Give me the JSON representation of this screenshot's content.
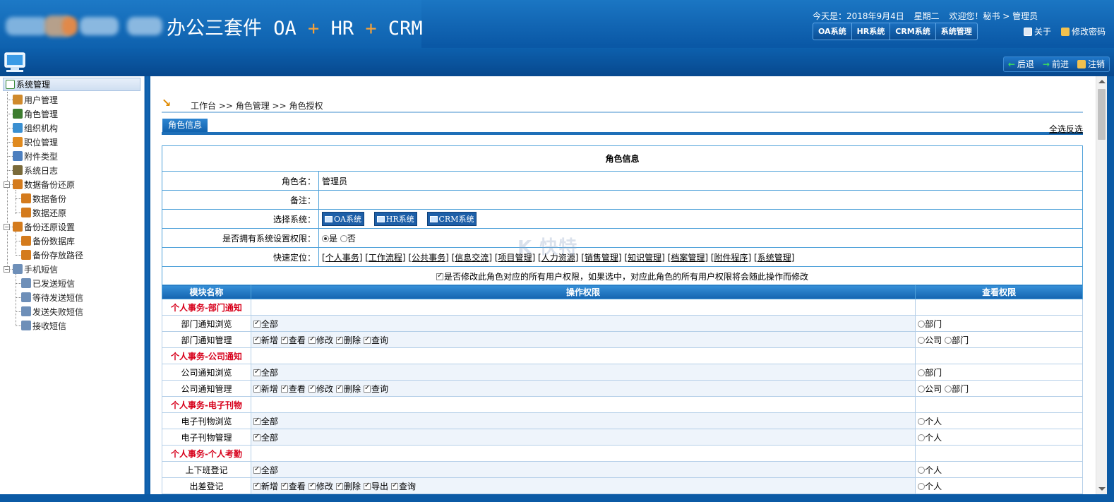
{
  "header": {
    "app_title": "办公三套件 OA + HR + CRM",
    "title_part1": "办公三套件 OA ",
    "title_part2": "HR",
    "title_part3": "CRM",
    "plus": "+",
    "date_text": "今天是：2018年9月4日",
    "weekday": "星期二",
    "welcome": "欢迎您！秘书 > 管理员",
    "system_tabs": [
      "OA系统",
      "HR系统",
      "CRM系统",
      "系统管理"
    ],
    "about": "关于",
    "change_password": "修改密码",
    "nav_back": "后退",
    "nav_forward": "前进",
    "nav_logout": "注销"
  },
  "sidebar": {
    "root": "系统管理",
    "items": [
      {
        "label": "用户管理",
        "color": "#d08a2c"
      },
      {
        "label": "角色管理",
        "color": "#3d7c2f"
      },
      {
        "label": "组织机构",
        "color": "#3a8fd1"
      },
      {
        "label": "职位管理",
        "color": "#e08a1f"
      },
      {
        "label": "附件类型",
        "color": "#4c7fbf"
      },
      {
        "label": "系统日志",
        "color": "#7a6a3a"
      },
      {
        "label": "数据备份还原",
        "color": "#d47b1d"
      },
      {
        "label": "数据备份",
        "color": "#d47b1d"
      },
      {
        "label": "数据还原",
        "color": "#d47b1d"
      },
      {
        "label": "备份还原设置",
        "color": "#d47b1d"
      },
      {
        "label": "备份数据库",
        "color": "#d47b1d"
      },
      {
        "label": "备份存放路径",
        "color": "#d47b1d"
      },
      {
        "label": "手机短信",
        "color": "#6e8fb8"
      },
      {
        "label": "已发送短信",
        "color": "#6e8fb8"
      },
      {
        "label": "等待发送短信",
        "color": "#6e8fb8"
      },
      {
        "label": "发送失败短信",
        "color": "#6e8fb8"
      },
      {
        "label": "接收短信",
        "color": "#6e8fb8"
      }
    ]
  },
  "main": {
    "breadcrumb": "工作台 >> 角色管理 >> 角色授权",
    "tab_label": "角色信息",
    "select_all": "全选反选",
    "info_title": "角色信息",
    "role_name_label": "角色名：",
    "role_name_value": "管理员",
    "remark_label": "备注：",
    "remark_value": "",
    "select_system_label": "选择系统：",
    "systems": [
      "OA系统",
      "HR系统",
      "CRM系统"
    ],
    "sys_perm_label": "是否拥有系统设置权限：",
    "yes": "是",
    "no": "否",
    "quick_label": "快速定位：",
    "quick_links": [
      "个人事务",
      "工作流程",
      "公共事务",
      "信息交流",
      "项目管理",
      "人力资源",
      "销售管理",
      "知识管理",
      "档案管理",
      "附件程序",
      "系统管理"
    ],
    "modify_note": "是否修改此角色对应的所有用户权限，如果选中，对应此角色的所有用户权限将会随此操作而修改",
    "watermark": "K 快特",
    "perm_headers": [
      "模块名称",
      "操作权限",
      "查看权限"
    ],
    "perm_rows": [
      {
        "type": "cat",
        "name": "个人事务-部门通知"
      },
      {
        "type": "item",
        "name": "部门通知浏览",
        "ops": [
          "全部"
        ],
        "views": [
          "部门"
        ]
      },
      {
        "type": "item",
        "name": "部门通知管理",
        "ops": [
          "新增",
          "查看",
          "修改",
          "删除",
          "查询"
        ],
        "views": [
          "公司",
          "部门"
        ]
      },
      {
        "type": "cat",
        "name": "个人事务-公司通知"
      },
      {
        "type": "item",
        "name": "公司通知浏览",
        "ops": [
          "全部"
        ],
        "views": [
          "部门"
        ]
      },
      {
        "type": "item",
        "name": "公司通知管理",
        "ops": [
          "新增",
          "查看",
          "修改",
          "删除",
          "查询"
        ],
        "views": [
          "公司",
          "部门"
        ]
      },
      {
        "type": "cat",
        "name": "个人事务-电子刊物"
      },
      {
        "type": "item",
        "name": "电子刊物浏览",
        "ops": [
          "全部"
        ],
        "views": [
          "个人"
        ]
      },
      {
        "type": "item",
        "name": "电子刊物管理",
        "ops": [
          "全部"
        ],
        "views": [
          "个人"
        ]
      },
      {
        "type": "cat",
        "name": "个人事务-个人考勤"
      },
      {
        "type": "item",
        "name": "上下班登记",
        "ops": [
          "全部"
        ],
        "views": [
          "个人"
        ]
      },
      {
        "type": "item",
        "name": "出差登记",
        "ops": [
          "新增",
          "查看",
          "修改",
          "删除",
          "导出",
          "查询"
        ],
        "views": [
          "个人"
        ]
      }
    ]
  },
  "colors": {
    "header_blue": "#0b5aa5",
    "accent_orange": "#f4a13a",
    "category_red": "#d7001b",
    "table_border": "#4ea1d9"
  }
}
